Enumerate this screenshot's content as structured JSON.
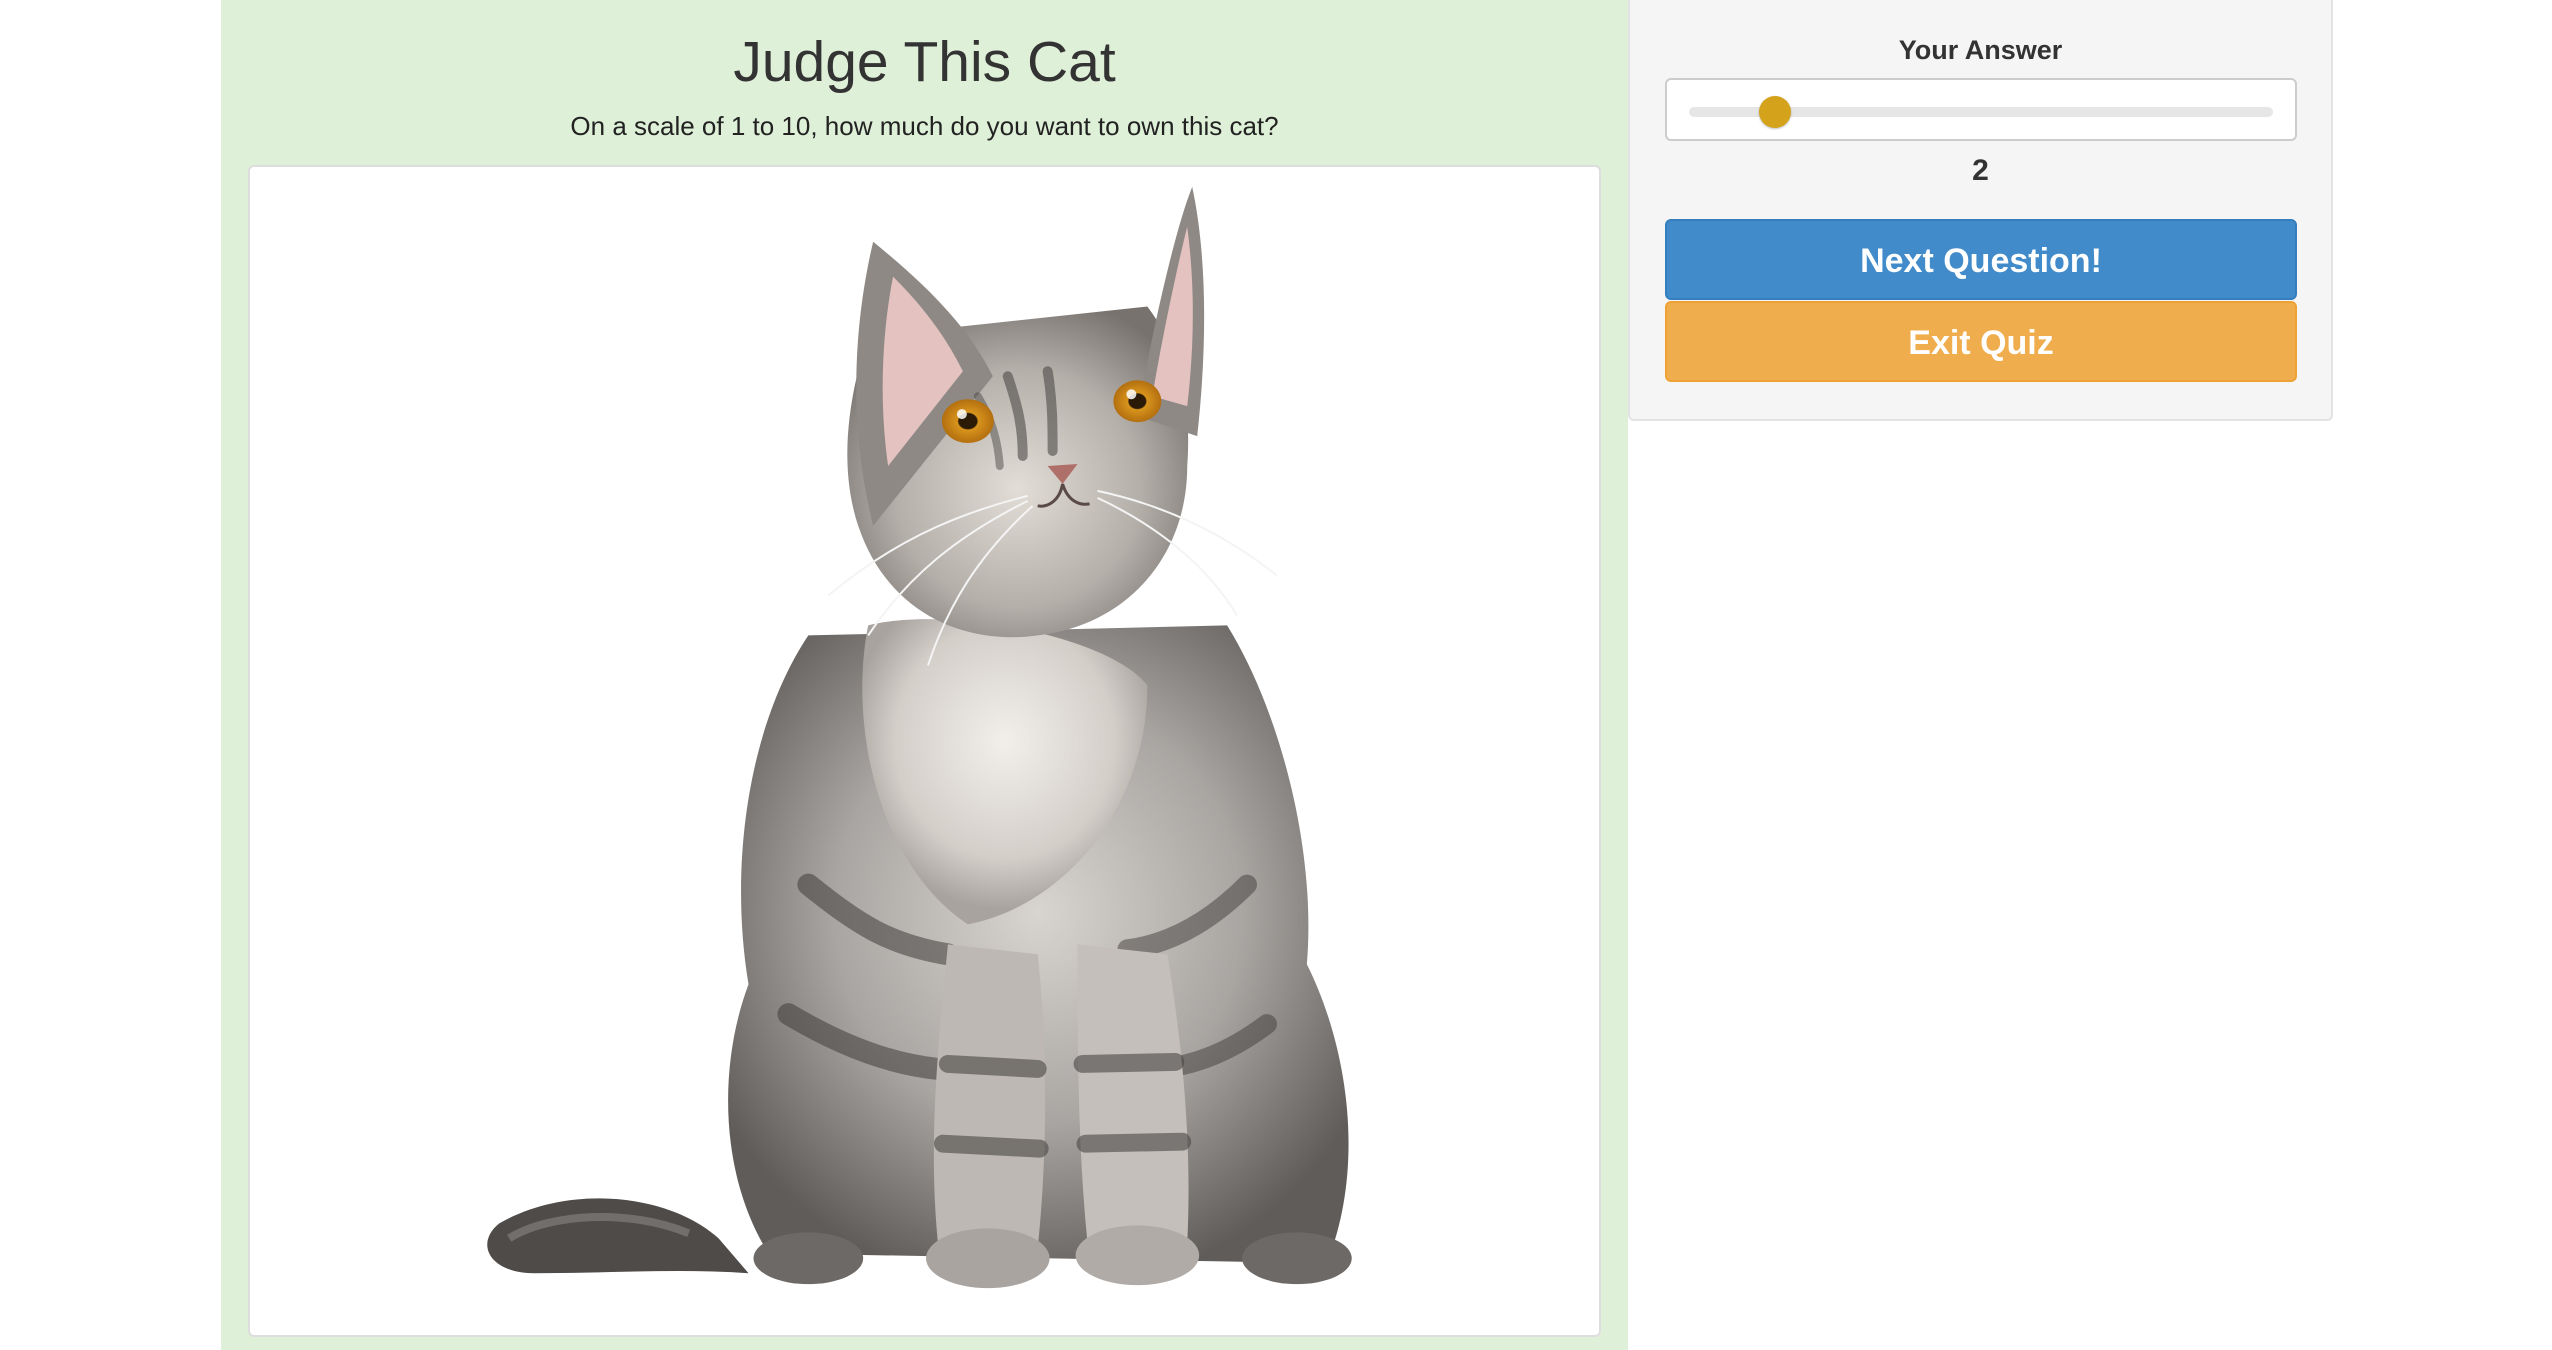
{
  "quiz": {
    "title": "Judge This Cat",
    "question": "On a scale of 1 to 10, how much do you want to own this cat?"
  },
  "answer": {
    "label": "Your Answer",
    "value": "2",
    "slider": {
      "min": 1,
      "max": 10,
      "current": 2,
      "thumb_color": "#d4a21b"
    }
  },
  "buttons": {
    "next_label": "Next Question!",
    "exit_label": "Exit Quiz"
  },
  "colors": {
    "main_panel_bg": "#dff0d8",
    "side_panel_bg": "#f5f5f5",
    "next_button": "#428bca",
    "exit_button": "#f0ad4e"
  },
  "image": {
    "subject": "cat-photo"
  }
}
